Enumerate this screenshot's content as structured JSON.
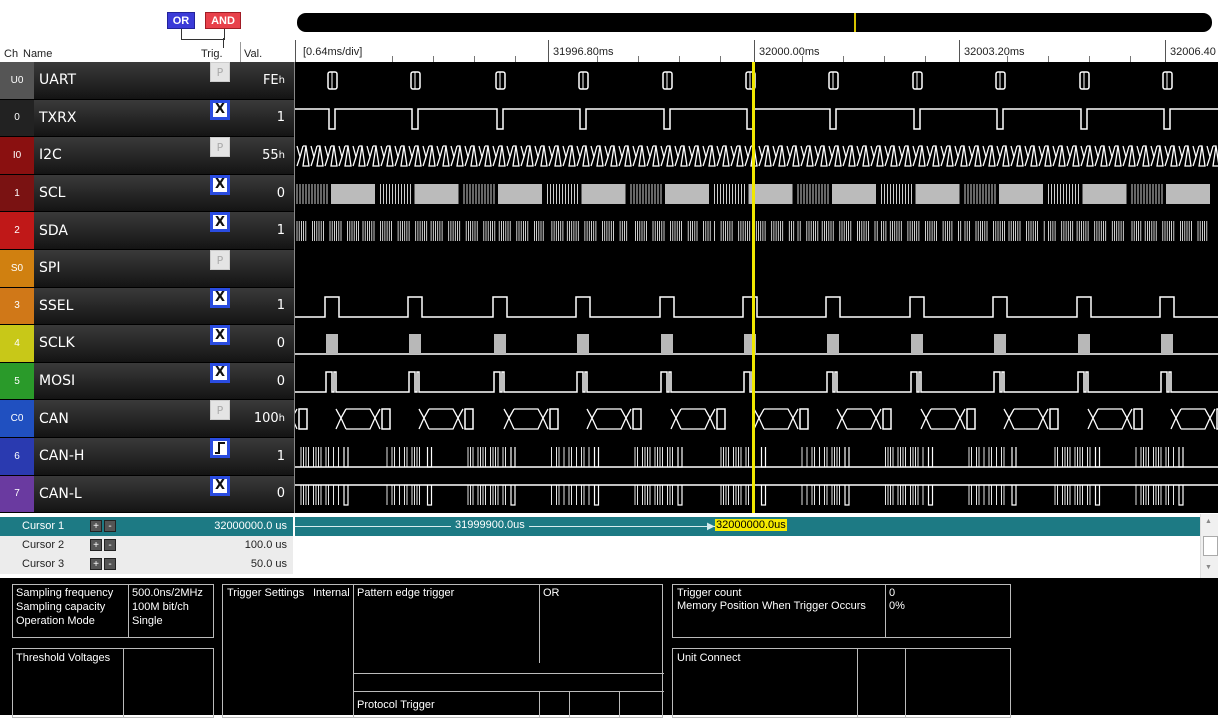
{
  "header": {
    "or_label": "OR",
    "and_label": "AND",
    "col_ch": "Ch",
    "col_name": "Name",
    "col_trig": "Trig.",
    "col_val": "Val."
  },
  "ruler": {
    "scale_label": "[0.64ms/div]",
    "ticks": [
      "31996.80ms",
      "32000.00ms",
      "32003.20ms",
      "32006.40"
    ]
  },
  "channels": [
    {
      "num": "U0",
      "name": "UART",
      "trig": "P",
      "val": "FEh",
      "color": "#555555",
      "wave": "uart"
    },
    {
      "num": "0",
      "name": "TXRX",
      "trig": "X",
      "val": "1",
      "color": "#222222",
      "wave": "txrx"
    },
    {
      "num": "I0",
      "name": "I2C",
      "trig": "P",
      "val": "55h",
      "color": "#8a1010",
      "wave": "i2c"
    },
    {
      "num": "1",
      "name": "SCL",
      "trig": "X",
      "val": "0",
      "color": "#7a1212",
      "wave": "scl"
    },
    {
      "num": "2",
      "name": "SDA",
      "trig": "X",
      "val": "1",
      "color": "#c01818",
      "wave": "sda"
    },
    {
      "num": "S0",
      "name": "SPI",
      "trig": "P",
      "val": "",
      "color": "#d08010",
      "wave": "none"
    },
    {
      "num": "3",
      "name": "SSEL",
      "trig": "X",
      "val": "1",
      "color": "#d07818",
      "wave": "ssel"
    },
    {
      "num": "4",
      "name": "SCLK",
      "trig": "X",
      "val": "0",
      "color": "#c8c818",
      "wave": "sclk"
    },
    {
      "num": "5",
      "name": "MOSI",
      "trig": "X",
      "val": "0",
      "color": "#2a9a2a",
      "wave": "mosi"
    },
    {
      "num": "C0",
      "name": "CAN",
      "trig": "P",
      "val": "100h",
      "color": "#2050c0",
      "wave": "can"
    },
    {
      "num": "6",
      "name": "CAN-H",
      "trig": "edge",
      "val": "1",
      "color": "#2a3ab0",
      "wave": "canh"
    },
    {
      "num": "7",
      "name": "CAN-L",
      "trig": "X",
      "val": "0",
      "color": "#6a3aa0",
      "wave": "canl"
    }
  ],
  "cursors": [
    {
      "name": "Cursor 1",
      "value": "32000000.0  us",
      "mid_label": "31999900.0us",
      "tag": "32000000.0us"
    },
    {
      "name": "Cursor 2",
      "value": "100.0  us"
    },
    {
      "name": "Cursor 3",
      "value": "50.0  us"
    }
  ],
  "info": {
    "sampling_frequency_label": "Sampling frequency",
    "sampling_frequency_value": "500.0ns/2MHz",
    "sampling_capacity_label": "Sampling capacity",
    "sampling_capacity_value": "100M bit/ch",
    "operation_mode_label": "Operation Mode",
    "operation_mode_value": "Single",
    "threshold_label": "Threshold Voltages",
    "trigger_settings_label": "Trigger Settings",
    "trigger_settings_value": "Internal",
    "pattern_edge_label": "Pattern edge trigger",
    "pattern_edge_value": "OR",
    "protocol_trigger_label": "Protocol Trigger",
    "trigger_count_label": "Trigger count",
    "trigger_count_value": "0",
    "memory_position_label": "Memory Position When Trigger Occurs",
    "memory_position_value": "0%",
    "unit_connect_label": "Unit Connect"
  }
}
